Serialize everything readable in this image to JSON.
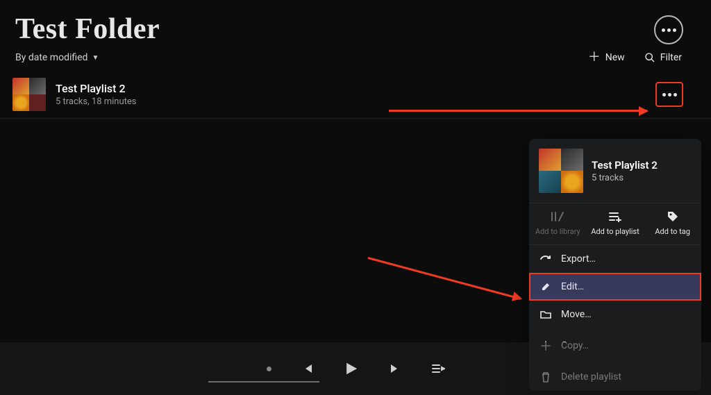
{
  "header": {
    "title": "Test Folder"
  },
  "toolbar": {
    "sort_label": "By date modified",
    "new_label": "New",
    "filter_label": "Filter"
  },
  "list": {
    "item_title": "Test Playlist 2",
    "item_sub": "5 tracks, 18 minutes"
  },
  "context_menu": {
    "title": "Test Playlist 2",
    "sub": "5 tracks",
    "actions": {
      "add_library": "Add to library",
      "add_playlist": "Add to playlist",
      "add_tag": "Add to tag"
    },
    "items": {
      "export": "Export…",
      "edit": "Edit…",
      "move": "Move…",
      "copy": "Copy…",
      "delete": "Delete playlist"
    }
  },
  "annotations": {
    "color": "#ef3b24"
  }
}
